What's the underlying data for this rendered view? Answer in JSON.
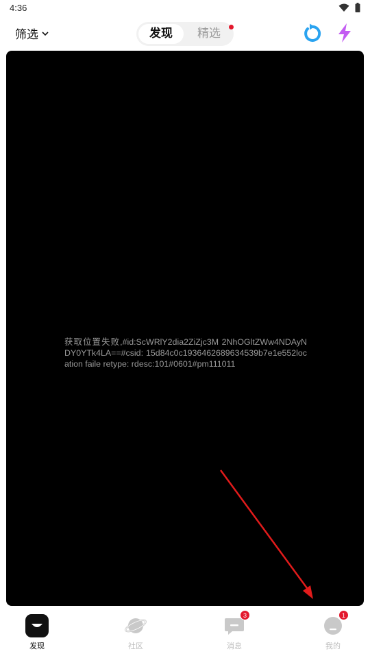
{
  "status_bar": {
    "time": "4:36",
    "icons": [
      "wifi-icon",
      "battery-icon"
    ]
  },
  "top_bar": {
    "filter_label": "筛选",
    "tabs": [
      {
        "label": "发现",
        "active": true
      },
      {
        "label": "精选",
        "active": false,
        "has_red_dot": true
      }
    ],
    "right_icons": [
      "refresh-icon",
      "lightning-icon"
    ]
  },
  "main": {
    "error_message": "获取位置失败,#id:ScWRlY2dia2ZiZjc3M 2NhOGltZWw4NDAyNDY0YTk4LA==#csid: 15d84c0c1936462689634539b7e1e552location faile retype: rdesc:101#0601#pm111011"
  },
  "bottom_nav": {
    "items": [
      {
        "label": "发现",
        "icon": "discover-icon",
        "active": true,
        "badge": ""
      },
      {
        "label": "社区",
        "icon": "planet-icon",
        "active": false,
        "badge": ""
      },
      {
        "label": "消息",
        "icon": "message-icon",
        "active": false,
        "badge": "3"
      },
      {
        "label": "我的",
        "icon": "profile-icon",
        "active": false,
        "badge": "1"
      }
    ]
  },
  "colors": {
    "accent_red": "#e3182d",
    "refresh_blue": "#2aa3f0",
    "lightning_purple": "#c35cf2"
  }
}
